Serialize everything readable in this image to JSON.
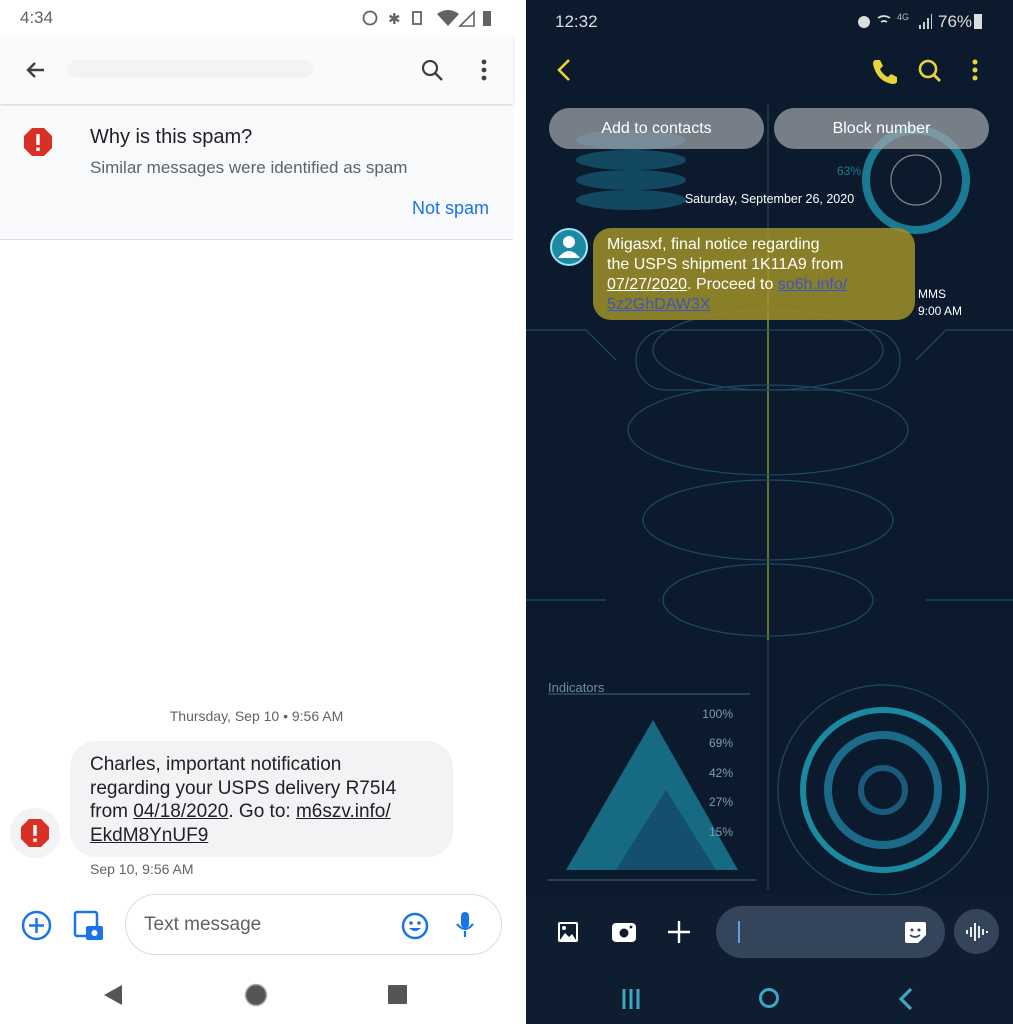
{
  "left": {
    "status": {
      "time": "4:34"
    },
    "appbar": {
      "back": "arrow-back-icon",
      "search": "search-icon",
      "more": "more-vert-icon"
    },
    "spam_banner": {
      "title": "Why is this spam?",
      "subtitle": "Similar messages were identified as spam",
      "action": "Not spam"
    },
    "date_header": "Thursday, Sep 10 • 9:56 AM",
    "message": {
      "l1": "Charles, important notification",
      "l2": "regarding your USPS delivery R75I4",
      "l3a": "from ",
      "date": "04/18/2020",
      "l3b": ". Go to: ",
      "link1": "m6szv.info/",
      "link2": "EkdM8YnUF9",
      "timestamp": "Sep 10, 9:56 AM"
    },
    "compose": {
      "placeholder": "Text message"
    },
    "colors": {
      "accent": "#1a73e8",
      "danger": "#d93025"
    }
  },
  "right": {
    "status": {
      "time": "12:32",
      "battery": "76%",
      "network": "4G"
    },
    "actions": {
      "add": "Add to contacts",
      "block": "Block number"
    },
    "date_header": "Saturday, September 26, 2020",
    "message": {
      "l1": "Migasxf, final notice regarding",
      "l2": "the USPS shipment 1K11A9 from",
      "date": "07/27/2020",
      "mid": ". Proceed to ",
      "link1": "so6h.info/",
      "link2": "5z2GhDAW3X",
      "type": "MMS",
      "time": "9:00 AM"
    },
    "wallpaper": {
      "label": "Indicators",
      "levels": [
        "100%",
        "69%",
        "42%",
        "27%",
        "15%"
      ],
      "p1": "63%"
    },
    "colors": {
      "accent": "#e8d33a",
      "bubble": "#a0912a",
      "background": "#0b1b2d"
    }
  }
}
